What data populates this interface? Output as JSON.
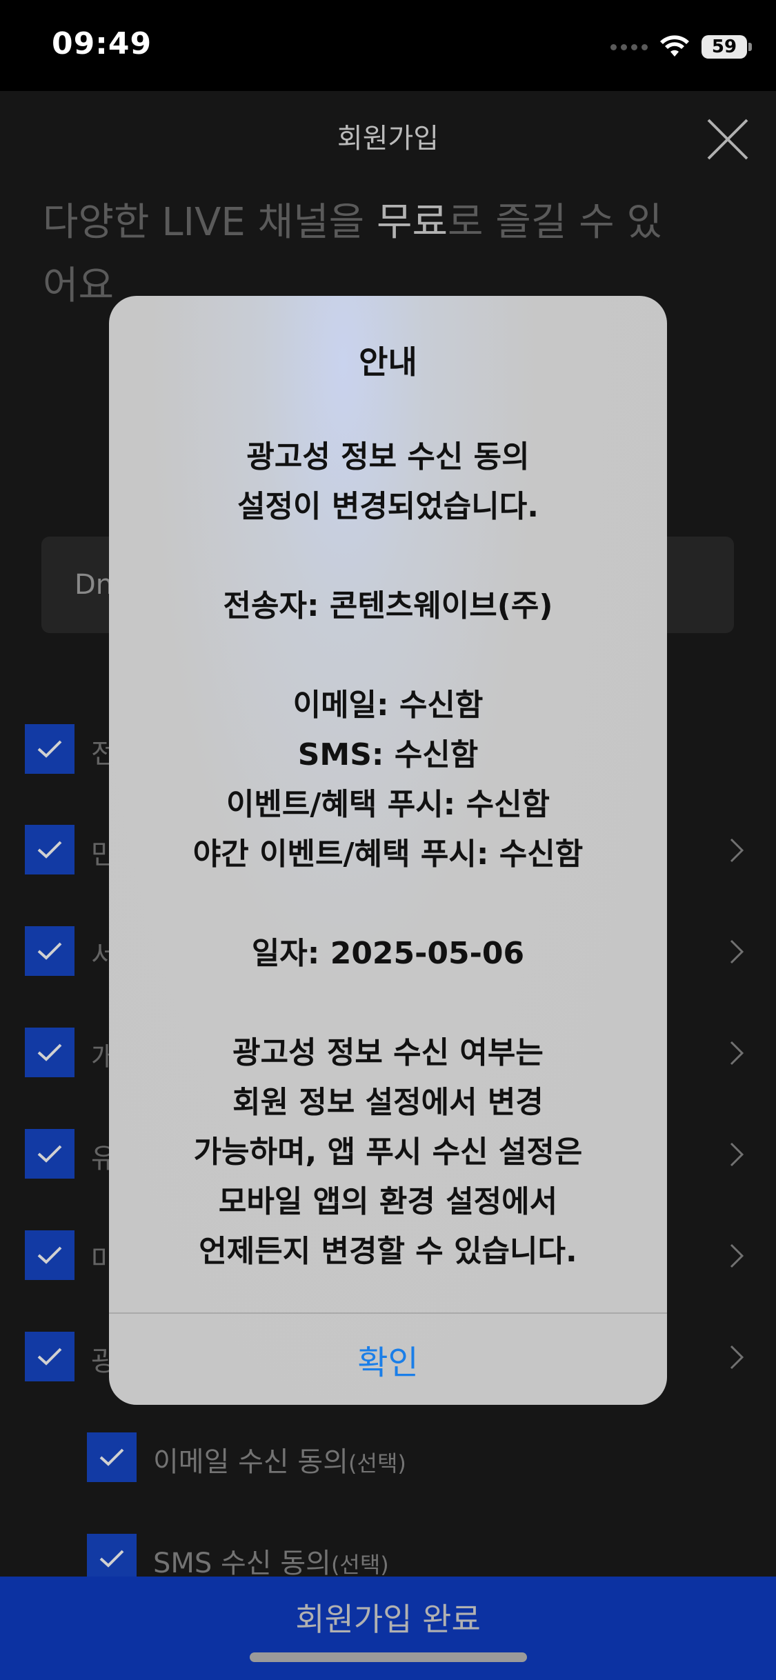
{
  "status": {
    "time": "09:49",
    "battery": "59"
  },
  "header": {
    "title": "회원가입"
  },
  "hero": {
    "part1": "다양한 LIVE 채널을 ",
    "highlight": "무료",
    "part2": "로 즐길 수 있어요"
  },
  "id_field": {
    "value": "Dn"
  },
  "agreements": [
    {
      "label": "전"
    },
    {
      "label": "만"
    },
    {
      "label": "서"
    },
    {
      "label": "개"
    },
    {
      "label": "유"
    },
    {
      "label": "마"
    },
    {
      "label": "광"
    }
  ],
  "sub_agreements": [
    {
      "label": "이메일 수신 동의",
      "suffix": "(선택)"
    },
    {
      "label": "SMS 수신 동의",
      "suffix": "(선택)"
    }
  ],
  "bottom_button": {
    "label": "회원가입 완료"
  },
  "alert": {
    "title": "안내",
    "lines": [
      "광고성 정보 수신 동의",
      "설정이 변경되었습니다.",
      "",
      "전송자: 콘텐츠웨이브(주)",
      "",
      "이메일: 수신함",
      "SMS: 수신함",
      "이벤트/혜택 푸시: 수신함",
      "야간 이벤트/혜택 푸시: 수신함",
      "",
      "일자: 2025-05-06",
      "",
      "광고성 정보 수신 여부는",
      "회원 정보 설정에서 변경",
      "가능하며, 앱 푸시 수신 설정은",
      "모바일 앱의 환경 설정에서",
      "언제든지 변경할 수 있습니다."
    ],
    "confirm_label": "확인"
  },
  "colors": {
    "accent": "#1747c8",
    "link": "#1a7ee8",
    "background": "#1b1b1b"
  }
}
